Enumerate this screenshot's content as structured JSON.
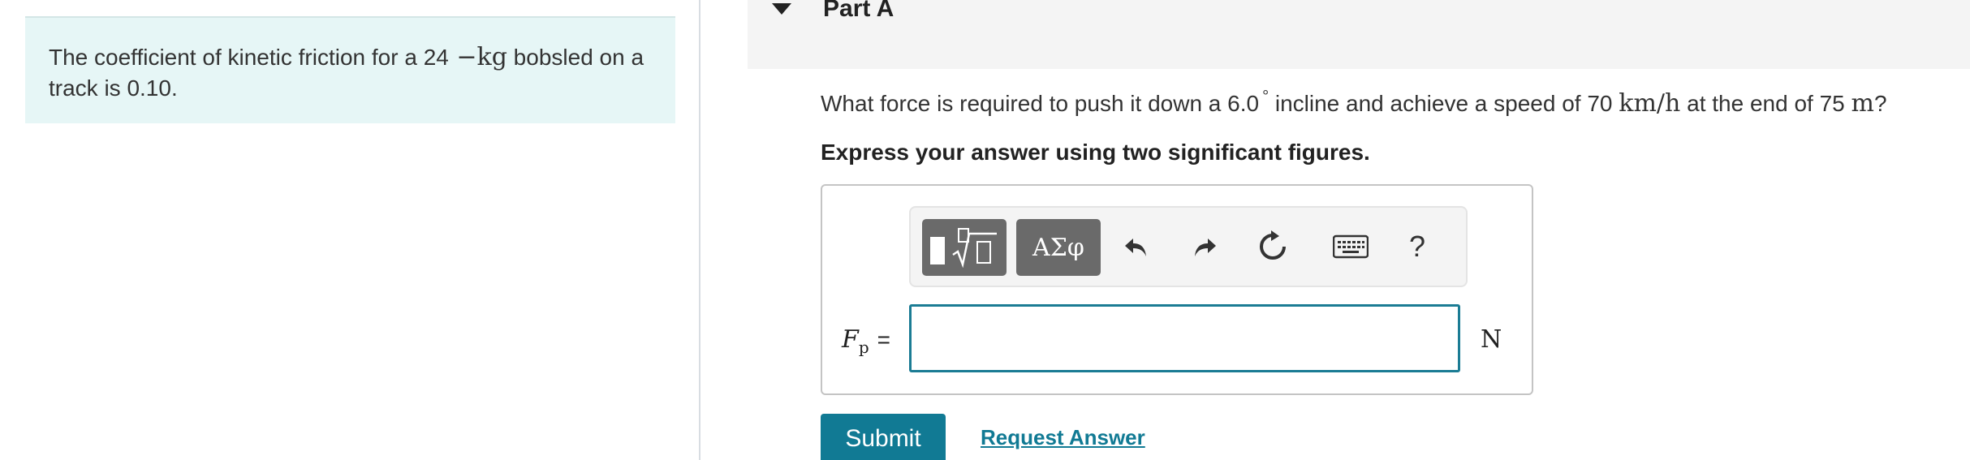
{
  "problem": {
    "text_before": "The coefficient of kinetic friction for a 24",
    "unit_math": " −kg",
    "text_after": " bobsled on a track is 0.10."
  },
  "part": {
    "title": "Part A"
  },
  "question": {
    "text_1": "What force is required to push it down a 6.0",
    "degree": "°",
    "text_2": "incline and achieve a speed of 70",
    "speed_unit": "km/h",
    "text_3": "at the end of 75",
    "dist_unit": "m",
    "text_4": "?"
  },
  "instruction": "Express your answer using two significant figures.",
  "toolbar": {
    "symbols_label": "ΑΣφ",
    "help_label": "?"
  },
  "answer": {
    "variable": "F",
    "subscript": "p",
    "equals": "=",
    "value": "",
    "unit": "N"
  },
  "buttons": {
    "submit": "Submit",
    "request_answer": "Request Answer"
  }
}
